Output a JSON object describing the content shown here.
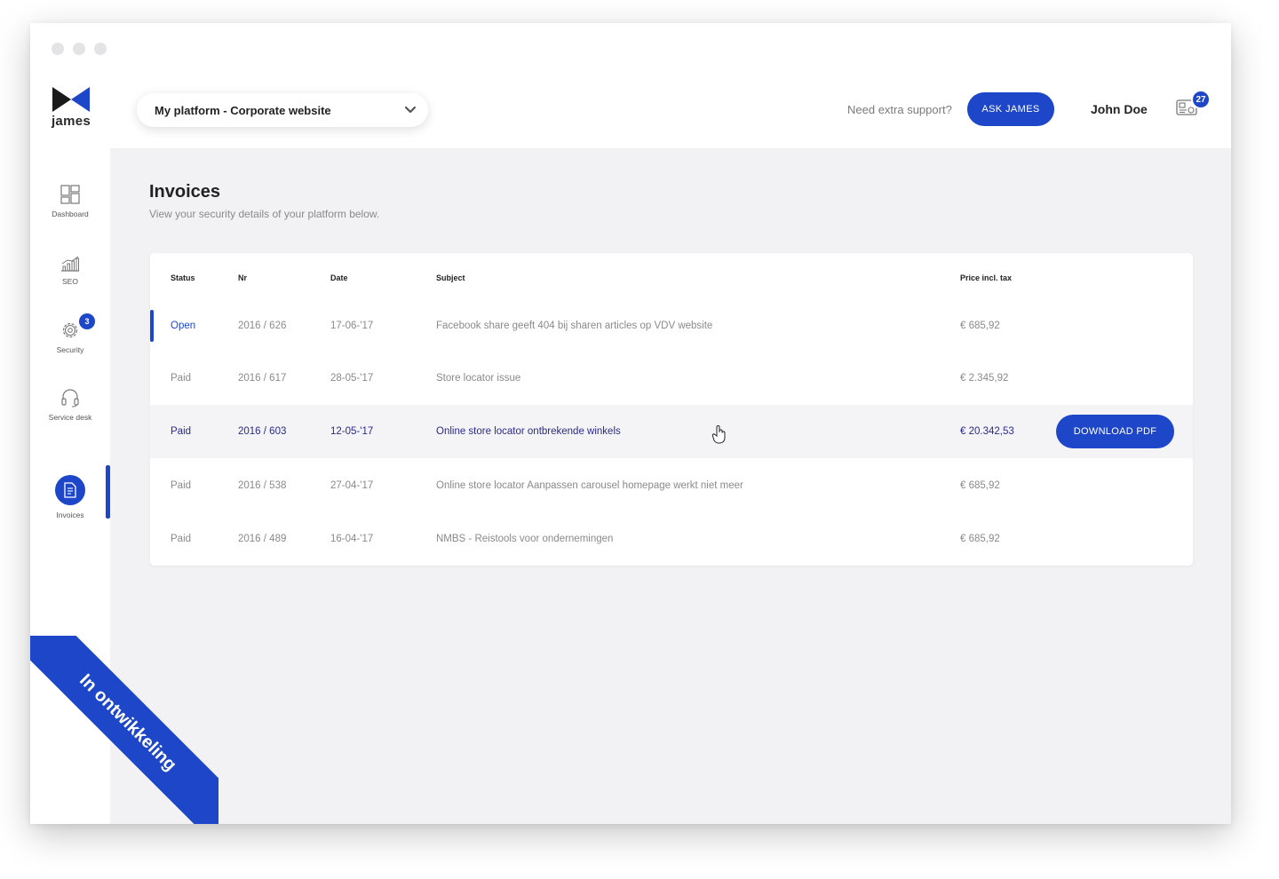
{
  "app": {
    "logo_text": "james"
  },
  "header": {
    "platform_select_value": "My platform - Corporate website",
    "support_text": "Need extra support?",
    "ask_button_label": "ASK JAMES",
    "user_name": "John Doe",
    "notification_count": "27",
    "notification_icon": "id-card-icon"
  },
  "sidebar": {
    "items": [
      {
        "label": "Dashboard",
        "icon": "dashboard-icon"
      },
      {
        "label": "SEO",
        "icon": "bar-chart-icon"
      },
      {
        "label": "Security",
        "icon": "gear-icon",
        "badge": "3"
      },
      {
        "label": "Service desk",
        "icon": "headset-icon"
      },
      {
        "label": "Invoices",
        "icon": "invoice-icon",
        "active": true
      }
    ]
  },
  "main": {
    "title": "Invoices",
    "subtitle": "View your security details of your platform below.",
    "table": {
      "headers": {
        "status": "Status",
        "nr": "Nr",
        "date": "Date",
        "subject": "Subject",
        "price": "Price incl. tax"
      },
      "rows": [
        {
          "status": "Open",
          "nr": "2016 / 626",
          "date": "17-06-'17",
          "subject": "Facebook share geeft 404 bij sharen articles op VDV website",
          "price": "€ 685,92"
        },
        {
          "status": "Paid",
          "nr": "2016 / 617",
          "date": "28-05-'17",
          "subject": "Store locator issue",
          "price": "€ 2.345,92"
        },
        {
          "status": "Paid",
          "nr": "2016 / 603",
          "date": "12-05-'17",
          "subject": "Online store locator ontbrekende winkels",
          "price": "€ 20.342,53"
        },
        {
          "status": "Paid",
          "nr": "2016 / 538",
          "date": "27-04-'17",
          "subject": "Online store locator Aanpassen carousel homepage werkt niet meer",
          "price": "€ 685,92"
        },
        {
          "status": "Paid",
          "nr": "2016 / 489",
          "date": "16-04-'17",
          "subject": "NMBS - Reistools voor ondernemingen",
          "price": "€ 685,92"
        }
      ],
      "download_button_label": "DOWNLOAD PDF"
    }
  },
  "ribbon": {
    "text": "In ontwikkeling"
  },
  "colors": {
    "accent": "#1d47c8",
    "background": "#f2f2f4"
  }
}
